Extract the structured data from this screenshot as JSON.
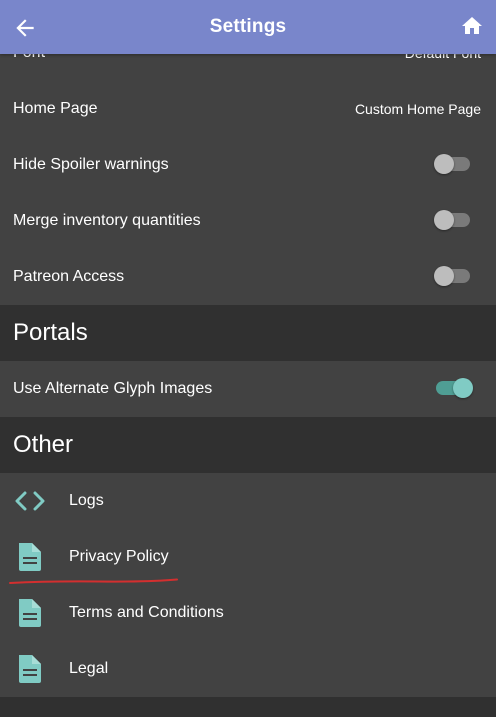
{
  "header": {
    "title": "Settings",
    "back_icon": "arrow-left-icon",
    "home_icon": "home-icon",
    "background_color": "#7986cb"
  },
  "settings": {
    "font": {
      "label": "Font",
      "value": "Default Font"
    },
    "home_page": {
      "label": "Home Page",
      "value": "Custom Home Page"
    },
    "hide_spoiler": {
      "label": "Hide Spoiler warnings",
      "enabled": false
    },
    "merge_inventory": {
      "label": "Merge inventory quantities",
      "enabled": false
    },
    "patreon": {
      "label": "Patreon Access",
      "enabled": false
    }
  },
  "portals": {
    "title": "Portals",
    "alt_glyph": {
      "label": "Use Alternate Glyph Images",
      "enabled": true
    }
  },
  "other": {
    "title": "Other",
    "items": [
      {
        "label": "Logs",
        "icon": "code-icon"
      },
      {
        "label": "Privacy Policy",
        "icon": "document-icon"
      },
      {
        "label": "Terms and Conditions",
        "icon": "document-icon"
      },
      {
        "label": "Legal",
        "icon": "document-icon"
      }
    ]
  },
  "colors": {
    "accent": "#80cbc4",
    "row_background": "#424242",
    "section_background": "#303030",
    "annotation": "#d32f2f"
  }
}
